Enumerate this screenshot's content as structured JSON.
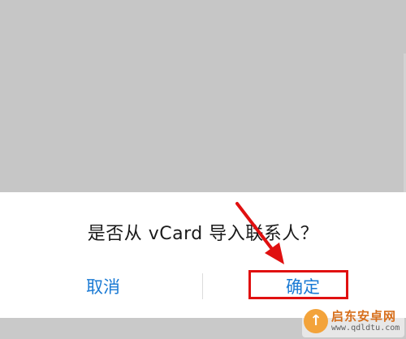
{
  "dialog": {
    "message": "是否从 vCard 导入联系人？",
    "cancel_label": "取消",
    "confirm_label": "确定"
  },
  "annotation": {
    "arrow_color": "#e01010",
    "highlight_color": "#e01010"
  },
  "watermark": {
    "title": "启东安卓网",
    "url": "www.qdldtu.com",
    "logo_icon": "rocket-icon"
  },
  "colors": {
    "button_text": "#1a7ad4",
    "background_scrim": "#c6c6c6",
    "dialog_bg": "#ffffff"
  }
}
